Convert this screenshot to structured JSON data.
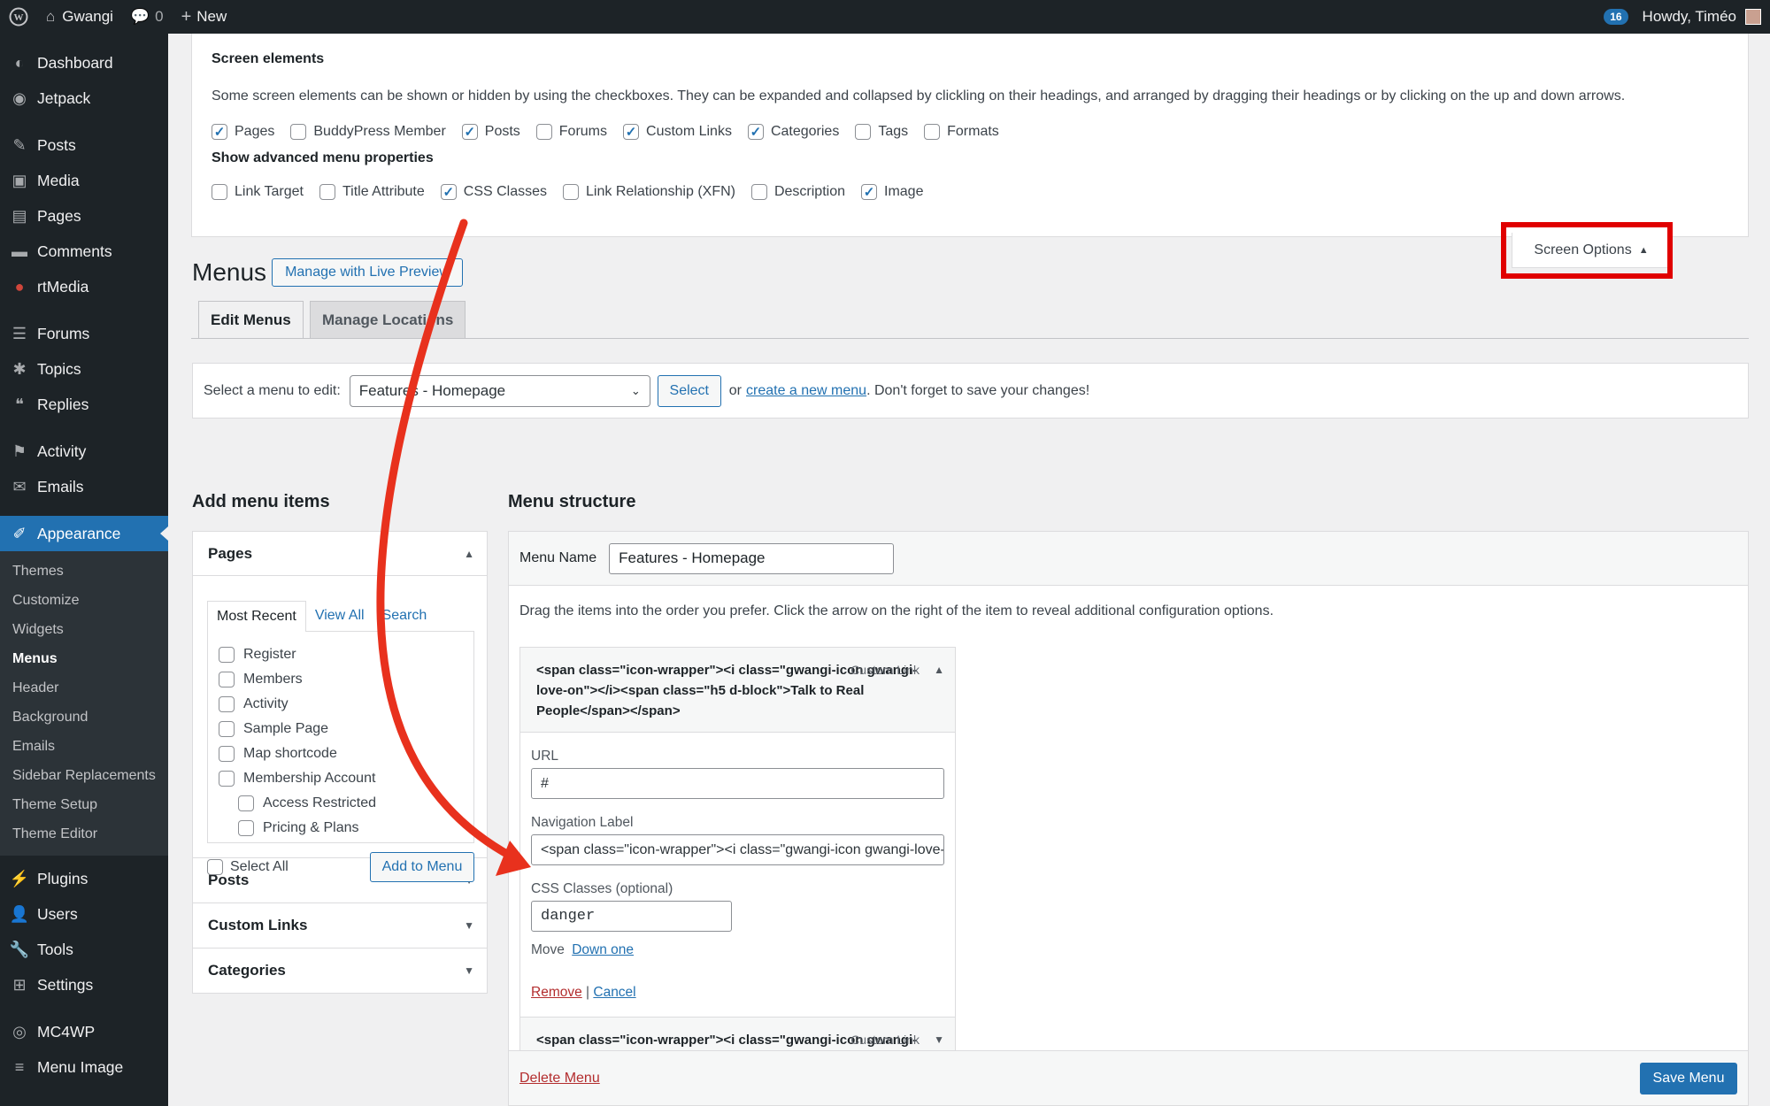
{
  "adminbar": {
    "site_name": "Gwangi",
    "comments_count": "0",
    "new_label": "New",
    "updates_count": "16",
    "howdy": "Howdy, Timéo"
  },
  "sidebar": {
    "items": [
      {
        "label": "Dashboard",
        "icon": "dashboard-icon"
      },
      {
        "label": "Jetpack",
        "icon": "jetpack-icon"
      },
      {
        "label": "Posts",
        "icon": "pin-icon"
      },
      {
        "label": "Media",
        "icon": "media-icon"
      },
      {
        "label": "Pages",
        "icon": "pages-icon"
      },
      {
        "label": "Comments",
        "icon": "comments-icon"
      },
      {
        "label": "rtMedia",
        "icon": "rtmedia-icon"
      },
      {
        "label": "Forums",
        "icon": "forums-icon"
      },
      {
        "label": "Topics",
        "icon": "topics-icon"
      },
      {
        "label": "Replies",
        "icon": "replies-icon"
      },
      {
        "label": "Activity",
        "icon": "activity-icon"
      },
      {
        "label": "Emails",
        "icon": "email-icon"
      },
      {
        "label": "Appearance",
        "icon": "appearance-icon"
      },
      {
        "label": "Plugins",
        "icon": "plugins-icon"
      },
      {
        "label": "Users",
        "icon": "users-icon"
      },
      {
        "label": "Tools",
        "icon": "tools-icon"
      },
      {
        "label": "Settings",
        "icon": "settings-icon"
      },
      {
        "label": "MC4WP",
        "icon": "mc4wp-icon"
      },
      {
        "label": "Menu Image",
        "icon": "menu-image-icon"
      }
    ],
    "appearance_submenu": [
      "Themes",
      "Customize",
      "Widgets",
      "Menus",
      "Header",
      "Background",
      "Emails",
      "Sidebar Replacements",
      "Theme Setup",
      "Theme Editor"
    ]
  },
  "screen_options": {
    "heading": "Screen elements",
    "description": "Some screen elements can be shown or hidden by using the checkboxes. They can be expanded and collapsed by clickling on their headings, and arranged by dragging their headings or by clicking on the up and down arrows.",
    "elements": [
      {
        "label": "Pages",
        "checked": true
      },
      {
        "label": "BuddyPress Member",
        "checked": false
      },
      {
        "label": "Posts",
        "checked": true
      },
      {
        "label": "Forums",
        "checked": false
      },
      {
        "label": "Custom Links",
        "checked": true
      },
      {
        "label": "Categories",
        "checked": true
      },
      {
        "label": "Tags",
        "checked": false
      },
      {
        "label": "Formats",
        "checked": false
      }
    ],
    "advanced_heading": "Show advanced menu properties",
    "advanced": [
      {
        "label": "Link Target",
        "checked": false
      },
      {
        "label": "Title Attribute",
        "checked": false
      },
      {
        "label": "CSS Classes",
        "checked": true
      },
      {
        "label": "Link Relationship (XFN)",
        "checked": false
      },
      {
        "label": "Description",
        "checked": false
      },
      {
        "label": "Image",
        "checked": true
      }
    ],
    "toggle_label": "Screen Options",
    "highlight_color": "#e00000"
  },
  "page": {
    "title": "Menus",
    "live_preview": "Manage with Live Preview",
    "tabs": [
      "Edit Menus",
      "Manage Locations"
    ]
  },
  "select_menu": {
    "label": "Select a menu to edit:",
    "value": "Features - Homepage",
    "button": "Select",
    "or_text": "or",
    "create_link": "create a new menu",
    "suffix": ". Don't forget to save your changes!"
  },
  "add_items": {
    "heading": "Add menu items",
    "pages_title": "Pages",
    "tabs": [
      "Most Recent",
      "View All",
      "Search"
    ],
    "pages": [
      {
        "label": "Register",
        "child": false
      },
      {
        "label": "Members",
        "child": false
      },
      {
        "label": "Activity",
        "child": false
      },
      {
        "label": "Sample Page",
        "child": false
      },
      {
        "label": "Map shortcode",
        "child": false
      },
      {
        "label": "Membership Account",
        "child": false
      },
      {
        "label": "Access Restricted",
        "child": true
      },
      {
        "label": "Pricing & Plans",
        "child": true
      }
    ],
    "select_all": "Select All",
    "add_button": "Add to Menu",
    "collapsed": [
      "Posts",
      "Custom Links",
      "Categories"
    ]
  },
  "menu_structure": {
    "heading": "Menu structure",
    "name_label": "Menu Name",
    "name_value": "Features - Homepage",
    "instructions": "Drag the items into the order you prefer. Click the arrow on the right of the item to reveal additional configuration options.",
    "item1": {
      "title": "<span class=\"icon-wrapper\"><i class=\"gwangi-icon gwangi-love-on\"></i><span class=\"h5 d-block\">Talk to Real People</span></span>",
      "type": "Custom Link",
      "url_label": "URL",
      "url_value": "#",
      "nav_label": "Navigation Label",
      "nav_value": "<span class=\"icon-wrapper\"><i class=\"gwangi-icon gwangi-love-on\">",
      "css_label": "CSS Classes (optional)",
      "css_value": "danger",
      "move_label": "Move",
      "move_link": "Down one",
      "remove": "Remove",
      "sep": "|",
      "cancel": "Cancel"
    },
    "item2": {
      "title": "<span class=\"icon-wrapper\"><i class=\"gwangi-icon gwangi-smile\"></i><span class=\"h5 d-block\">Smooth & Simple Features</span></span>",
      "type": "Custom Link"
    },
    "delete": "Delete Menu",
    "save": "Save Menu"
  },
  "annotation": {
    "arrow_color": "#e8311d"
  }
}
